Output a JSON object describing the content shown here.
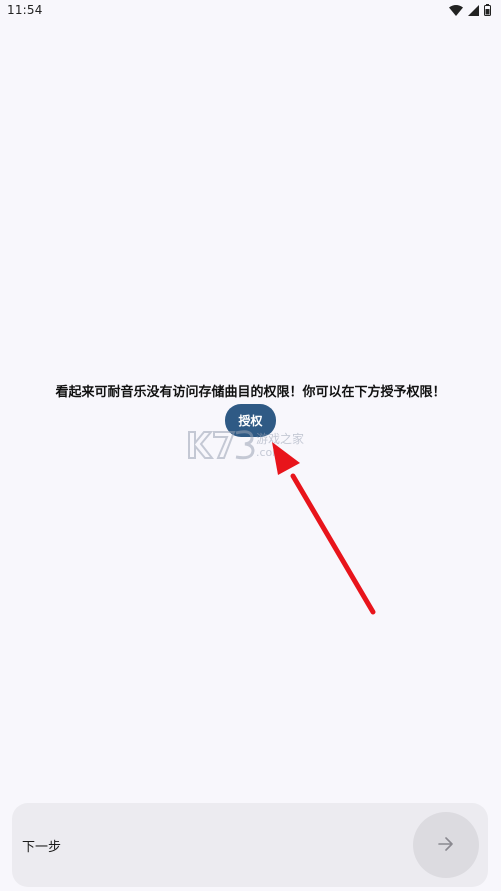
{
  "status_bar": {
    "time": "11:54",
    "icons": [
      "wifi-icon",
      "cellular-signal-icon",
      "battery-icon"
    ]
  },
  "main": {
    "permission_message": "看起来可耐音乐没有访问存储曲目的权限！你可以在下方授予权限！",
    "grant_button_label": "授权"
  },
  "watermark": {
    "brand": "K73",
    "text": "游戏之家",
    "domain": ".com"
  },
  "footer": {
    "next_label": "下一步",
    "next_icon": "arrow-right-icon"
  },
  "colors": {
    "background": "#f8f7fc",
    "accent": "#2f5a85",
    "annotation_arrow": "#e8141b"
  }
}
